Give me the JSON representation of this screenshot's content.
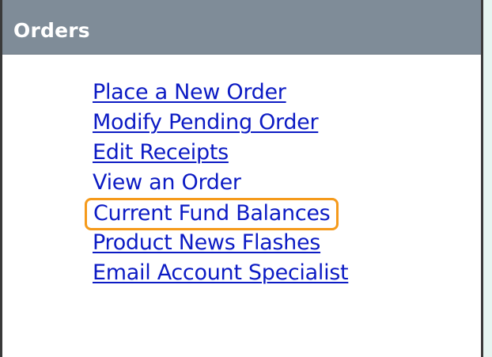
{
  "panel": {
    "title": "Orders"
  },
  "links": [
    {
      "label": "Place a New Order",
      "highlighted": false
    },
    {
      "label": "Modify Pending Order",
      "highlighted": false
    },
    {
      "label": "Edit Receipts",
      "highlighted": false
    },
    {
      "label": "View an Order",
      "highlighted": false
    },
    {
      "label": "Current Fund Balances",
      "highlighted": true
    },
    {
      "label": "Product News Flashes",
      "highlighted": false
    },
    {
      "label": "Email Account Specialist",
      "highlighted": false
    }
  ],
  "colors": {
    "header_bg": "#7f8c98",
    "link": "#0c1bc4",
    "highlight_border": "#f59a1b"
  }
}
